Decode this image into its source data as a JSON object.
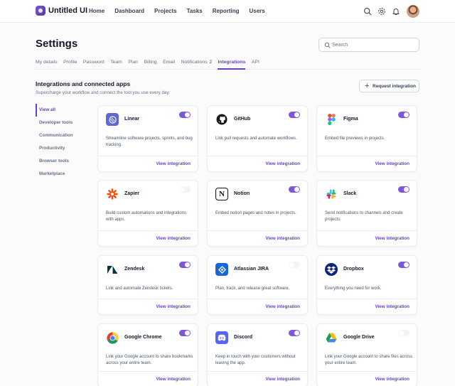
{
  "brand": "Untitled UI",
  "nav": [
    "Home",
    "Dashboard",
    "Projects",
    "Tasks",
    "Reporting",
    "Users"
  ],
  "page_title": "Settings",
  "search": {
    "placeholder": "Search"
  },
  "tabs": [
    {
      "label": "My details"
    },
    {
      "label": "Profile"
    },
    {
      "label": "Password"
    },
    {
      "label": "Team"
    },
    {
      "label": "Plan"
    },
    {
      "label": "Billing"
    },
    {
      "label": "Email"
    },
    {
      "label": "Notifications",
      "badge": "2"
    },
    {
      "label": "Integrations",
      "active": true
    },
    {
      "label": "API"
    }
  ],
  "section": {
    "title": "Integrations and connected apps",
    "subtitle": "Supercharge your workflow and connect the tool you use every day.",
    "request_button": "Request integration"
  },
  "filters": [
    "View all",
    "Developer tools",
    "Communication",
    "Productivity",
    "Browser tools",
    "Marketplace"
  ],
  "view_label": "View integration",
  "accent": "#7f56d9",
  "cards": [
    {
      "name": "Linear",
      "enabled": true,
      "icon": "linear-icon",
      "desc": "Streamline software projects, sprints, and bug tracking."
    },
    {
      "name": "GitHub",
      "enabled": true,
      "icon": "github-icon",
      "desc": "Link pull requests and automate workflows."
    },
    {
      "name": "Figma",
      "enabled": true,
      "icon": "figma-icon",
      "desc": "Embed file previews in projects."
    },
    {
      "name": "Zapier",
      "enabled": false,
      "icon": "zapier-icon",
      "desc": "Build custom automations and integrations with apps."
    },
    {
      "name": "Notion",
      "enabled": true,
      "icon": "notion-icon",
      "desc": "Embed notion pages and notes in projects."
    },
    {
      "name": "Slack",
      "enabled": true,
      "icon": "slack-icon",
      "desc": "Send notifications to channels and create projects."
    },
    {
      "name": "Zendesk",
      "enabled": true,
      "icon": "zendesk-icon",
      "desc": "Link and automate Zendesk tickets."
    },
    {
      "name": "Atlassian JIRA",
      "enabled": false,
      "icon": "jira-icon",
      "desc": "Plan, track, and release great software."
    },
    {
      "name": "Dropbox",
      "enabled": true,
      "icon": "dropbox-icon",
      "desc": "Everything you need for work."
    },
    {
      "name": "Google Chrome",
      "enabled": true,
      "icon": "chrome-icon",
      "desc": "Link your Google account to share bookmarks across your entire team."
    },
    {
      "name": "Discord",
      "enabled": true,
      "icon": "discord-icon",
      "desc": "Keep in touch with your customers without leaving the app."
    },
    {
      "name": "Google Drive",
      "enabled": false,
      "icon": "google-drive-icon",
      "desc": "Link your Google account to share files across your entire team."
    }
  ]
}
